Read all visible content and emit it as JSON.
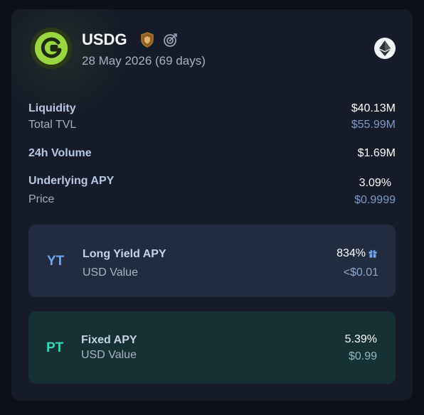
{
  "header": {
    "name": "USDG",
    "maturity": "28 May 2026 (69 days)"
  },
  "stats": {
    "liquidity_label": "Liquidity",
    "liquidity_value": "$40.13M",
    "tvl_label": "Total TVL",
    "tvl_value": "$55.99M",
    "volume_label": "24h Volume",
    "volume_value": "$1.69M",
    "apy_label": "Underlying APY",
    "apy_value": "3.09%",
    "price_label": "Price",
    "price_value": "$0.9999"
  },
  "yt": {
    "badge": "YT",
    "title": "Long Yield APY",
    "sub": "USD Value",
    "apy": "834%",
    "usd": "<$0.01"
  },
  "pt": {
    "badge": "PT",
    "title": "Fixed APY",
    "sub": "USD Value",
    "apy": "5.39%",
    "usd": "$0.99"
  },
  "colors": {
    "logo_green": "#9ad640",
    "yt_accent": "#6fa6f4",
    "pt_accent": "#34d7b2",
    "shield": "#b07a2e"
  },
  "icons": [
    "token-logo-icon",
    "shield-icon",
    "target-icon",
    "ethereum-icon",
    "gift-icon"
  ]
}
